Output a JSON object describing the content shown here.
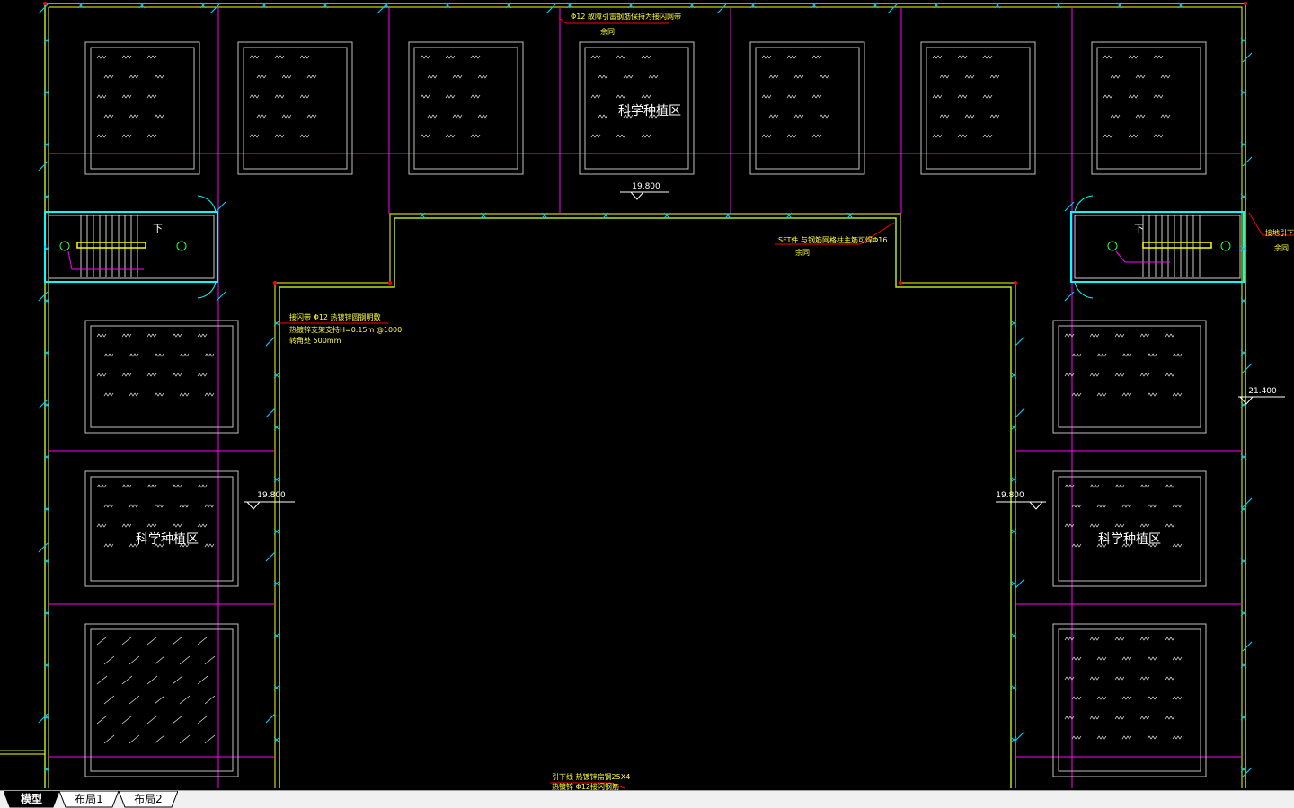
{
  "drawing": {
    "zone_label": "科学种植区",
    "elev_top": "19.800",
    "elev_left": "19.800",
    "elev_right": "19.800",
    "elev_far_right": "21.400",
    "note_top_line1": "Φ12 故障引雷钢筋保持为接闪网带",
    "note_top_line2": "余同",
    "note_mid_line1": "SFT件 与钢筋网格柱主筋可焊Φ16",
    "note_mid_line2": "余同",
    "note_left_line1": "接闪带 Φ12 热镀锌圆钢明敷",
    "note_left_line2": "热镀锌支架支持H=0.15m @1000",
    "note_left_line3": "转角处 500mm",
    "note_right_line1": "接地引下线",
    "note_right_line2": "余同",
    "note_bottom_line1": "引下线 热镀锌扁钢25X4",
    "note_bottom_line2": "热镀锌 Φ12接闪钢筋",
    "stair_down_left": "下",
    "stair_down_right": "下"
  },
  "colors": {
    "wall_yellow": "#ffff00",
    "wall_green": "#b5e61d",
    "grid_magenta": "#ff00ff",
    "bed_white": "#ffffff",
    "glass_cyan": "#00ffff",
    "note_red": "#ff0000",
    "marker_cyan": "#00c8ff"
  },
  "tabs": [
    {
      "label": "模型",
      "active": true
    },
    {
      "label": "布局1",
      "active": false
    },
    {
      "label": "布局2",
      "active": false
    }
  ]
}
